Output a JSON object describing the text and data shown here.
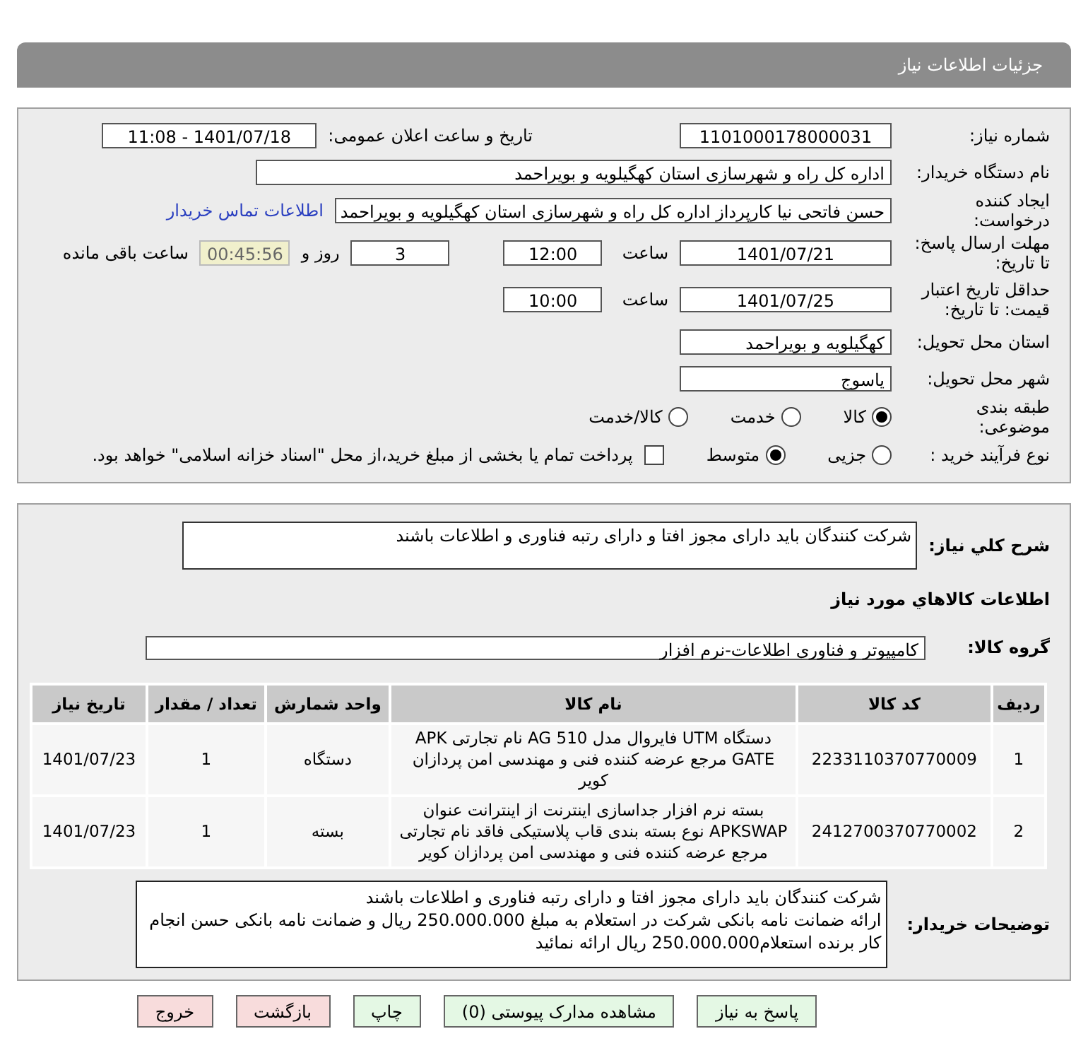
{
  "header": {
    "title": "جزئیات اطلاعات نیاز"
  },
  "details": {
    "need_number": {
      "label": "شماره نیاز:",
      "value": "1101000178000031"
    },
    "announce": {
      "label": "تاریخ و ساعت اعلان عمومی:",
      "value": "1401/07/18 - 11:08"
    },
    "buyer": {
      "label": "نام دستگاه خریدار:",
      "value": "اداره کل راه و شهرسازی استان کهگیلویه و بویراحمد"
    },
    "requester": {
      "label": "ایجاد کننده درخواست:",
      "value": "حسن فاتحی نیا کارپرداز اداره کل راه و شهرسازی استان کهگیلویه و بویراحمد",
      "link": "اطلاعات تماس خریدار"
    },
    "deadline": {
      "label": "مهلت ارسال پاسخ: تا تاریخ:",
      "date": "1401/07/21",
      "time_label": "ساعت",
      "time": "12:00",
      "days": "3",
      "days_label": "روز و",
      "remaining": "00:45:56",
      "remaining_label": "ساعت باقی مانده"
    },
    "validity": {
      "label": "حداقل تاریخ اعتبار قیمت: تا تاریخ:",
      "date": "1401/07/25",
      "time_label": "ساعت",
      "time": "10:00"
    },
    "province": {
      "label": "استان محل تحویل:",
      "value": "کهگیلویه و بویراحمد"
    },
    "city": {
      "label": "شهر محل تحویل:",
      "value": "یاسوج"
    },
    "category": {
      "label": "طبقه بندی موضوعی:",
      "options": [
        {
          "label": "کالا",
          "selected": true
        },
        {
          "label": "خدمت",
          "selected": false
        },
        {
          "label": "کالا/خدمت",
          "selected": false
        }
      ]
    },
    "process": {
      "label": "نوع فرآیند خرید :",
      "options": [
        {
          "label": "جزیی",
          "selected": false
        },
        {
          "label": "متوسط",
          "selected": true
        }
      ],
      "payment": {
        "label": "پرداخت تمام یا بخشی از مبلغ خرید،از محل \"اسناد خزانه اسلامی\" خواهد بود.",
        "checked": false
      }
    }
  },
  "summary": {
    "label": "شرح کلي نياز:",
    "value": "شرکت کنندگان باید دارای مجوز افتا و دارای رتبه فناوری و اطلاعات باشند",
    "goods_title": "اطلاعات کالاهاي مورد نياز",
    "group": {
      "label": "گروه کالا:",
      "value": "کامپیوتر و فناوری اطلاعات-نرم افزار"
    },
    "table": {
      "columns": [
        "ردیف",
        "کد کالا",
        "نام کالا",
        "واحد شمارش",
        "تعداد / مقدار",
        "تاریخ نیاز"
      ],
      "rows": [
        [
          "1",
          "2233110370770009",
          "دستگاه UTM فایروال مدل AG 510 نام تجارتی APK GATE مرجع عرضه کننده فنی و مهندسی امن پردازان کویر",
          "دستگاه",
          "1",
          "1401/07/23"
        ],
        [
          "2",
          "2412700370770002",
          "بسته نرم افزار جداسازی اینترنت از اینترانت عنوان APKSWAP نوع بسته بندی قاب پلاستیکی فاقد نام تجارتی مرجع عرضه کننده فنی و مهندسی امن پردازان کویر",
          "بسته",
          "1",
          "1401/07/23"
        ]
      ]
    },
    "notes": {
      "label": "توضیحات خریدار:",
      "lines": [
        "شرکت کنندگان باید دارای مجوز افتا و دارای رتبه فناوری و اطلاعات باشند",
        "ارائه ضمانت نامه بانکی شرکت در استعلام به مبلغ 250.000.000 ریال و ضمانت نامه بانکی حسن انجام کار برنده استعلام250.000.000 ریال ارائه نمائید"
      ]
    }
  },
  "buttons": [
    {
      "label": "پاسخ به نیاز",
      "kind": "action"
    },
    {
      "label": "مشاهده مدارک پیوستی (0)",
      "kind": "action"
    },
    {
      "label": "چاپ",
      "kind": "action"
    },
    {
      "label": "بازگشت",
      "kind": "exit"
    },
    {
      "label": "خروج",
      "kind": "exit"
    }
  ]
}
